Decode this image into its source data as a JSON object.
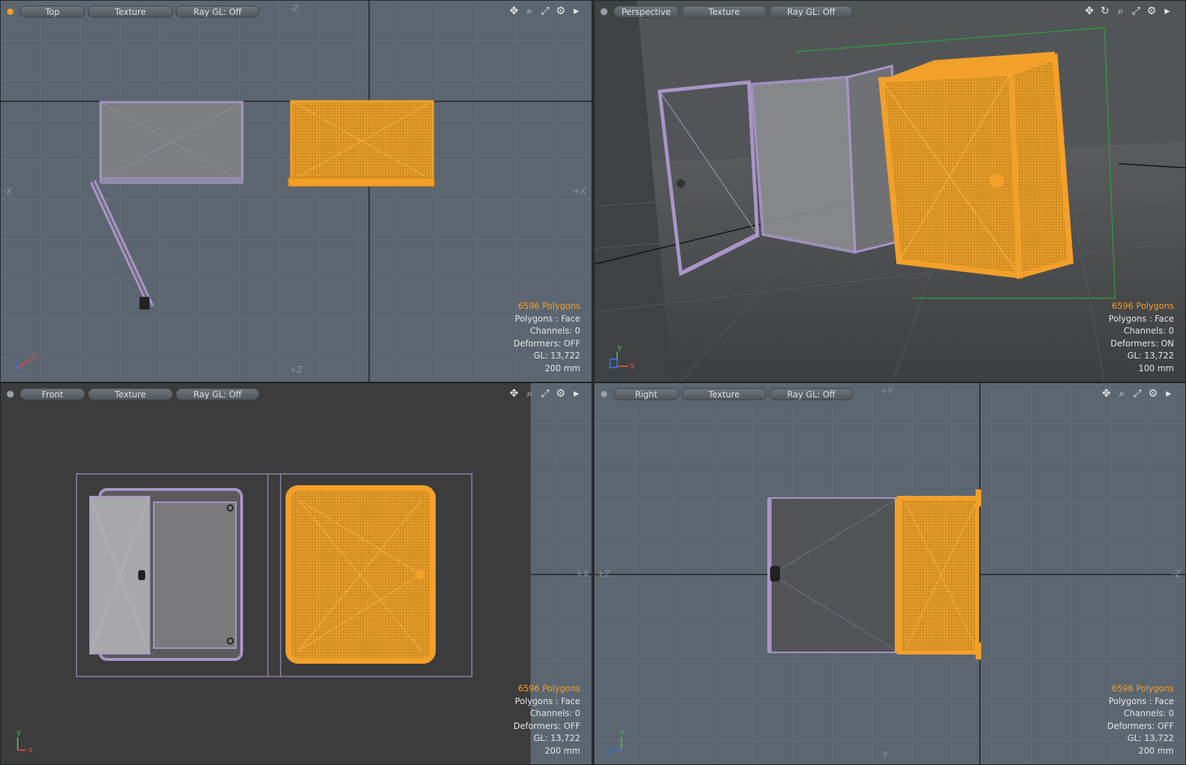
{
  "colors": {
    "selection": "#f3a02a",
    "unselected_wire": "#a896c8",
    "grid_bg": "#5c6670",
    "persp_bg": "#4a4d50",
    "front_bg": "#3c3c3c"
  },
  "viewports": {
    "top": {
      "view": "Top",
      "shading": "Texture",
      "raygl": "Ray GL: Off",
      "axis_top": "-Z",
      "axis_bottom": "+Z",
      "axis_left": "-X",
      "axis_right": "+X",
      "info": {
        "polygons": "6596 Polygons",
        "mode": "Polygons : Face",
        "channels": "Channels: 0",
        "deformers": "Deformers: OFF",
        "gl": "GL: 13,722",
        "scale": "200 mm"
      }
    },
    "perspective": {
      "view": "Perspective",
      "shading": "Texture",
      "raygl": "Ray GL: Off",
      "info": {
        "polygons": "6596 Polygons",
        "mode": "Polygons : Face",
        "channels": "Channels: 0",
        "deformers": "Deformers: ON",
        "gl": "GL: 13,722",
        "scale": "100 mm"
      }
    },
    "front": {
      "view": "Front",
      "shading": "Texture",
      "raygl": "Ray GL: Off",
      "axis_right": "+X",
      "info": {
        "polygons": "6596 Polygons",
        "mode": "Polygons : Face",
        "channels": "Channels: 0",
        "deformers": "Deformers: OFF",
        "gl": "GL: 13,722",
        "scale": "200 mm"
      }
    },
    "right": {
      "view": "Right",
      "shading": "Texture",
      "raygl": "Ray GL: Off",
      "axis_top": "+Y",
      "axis_bottom": "-Y",
      "axis_left": "+Z",
      "axis_right": "-Z",
      "info": {
        "polygons": "6596 Polygons",
        "mode": "Polygons : Face",
        "channels": "Channels: 0",
        "deformers": "Deformers: OFF",
        "gl": "GL: 13,722",
        "scale": "200 mm"
      }
    }
  },
  "gizmo": {
    "x": "X",
    "y": "Y",
    "z": "Z"
  },
  "icons": [
    "move-view-icon",
    "rotate-view-icon",
    "zoom-icon",
    "maximize-icon",
    "gear-icon",
    "expand-arrow-icon"
  ]
}
